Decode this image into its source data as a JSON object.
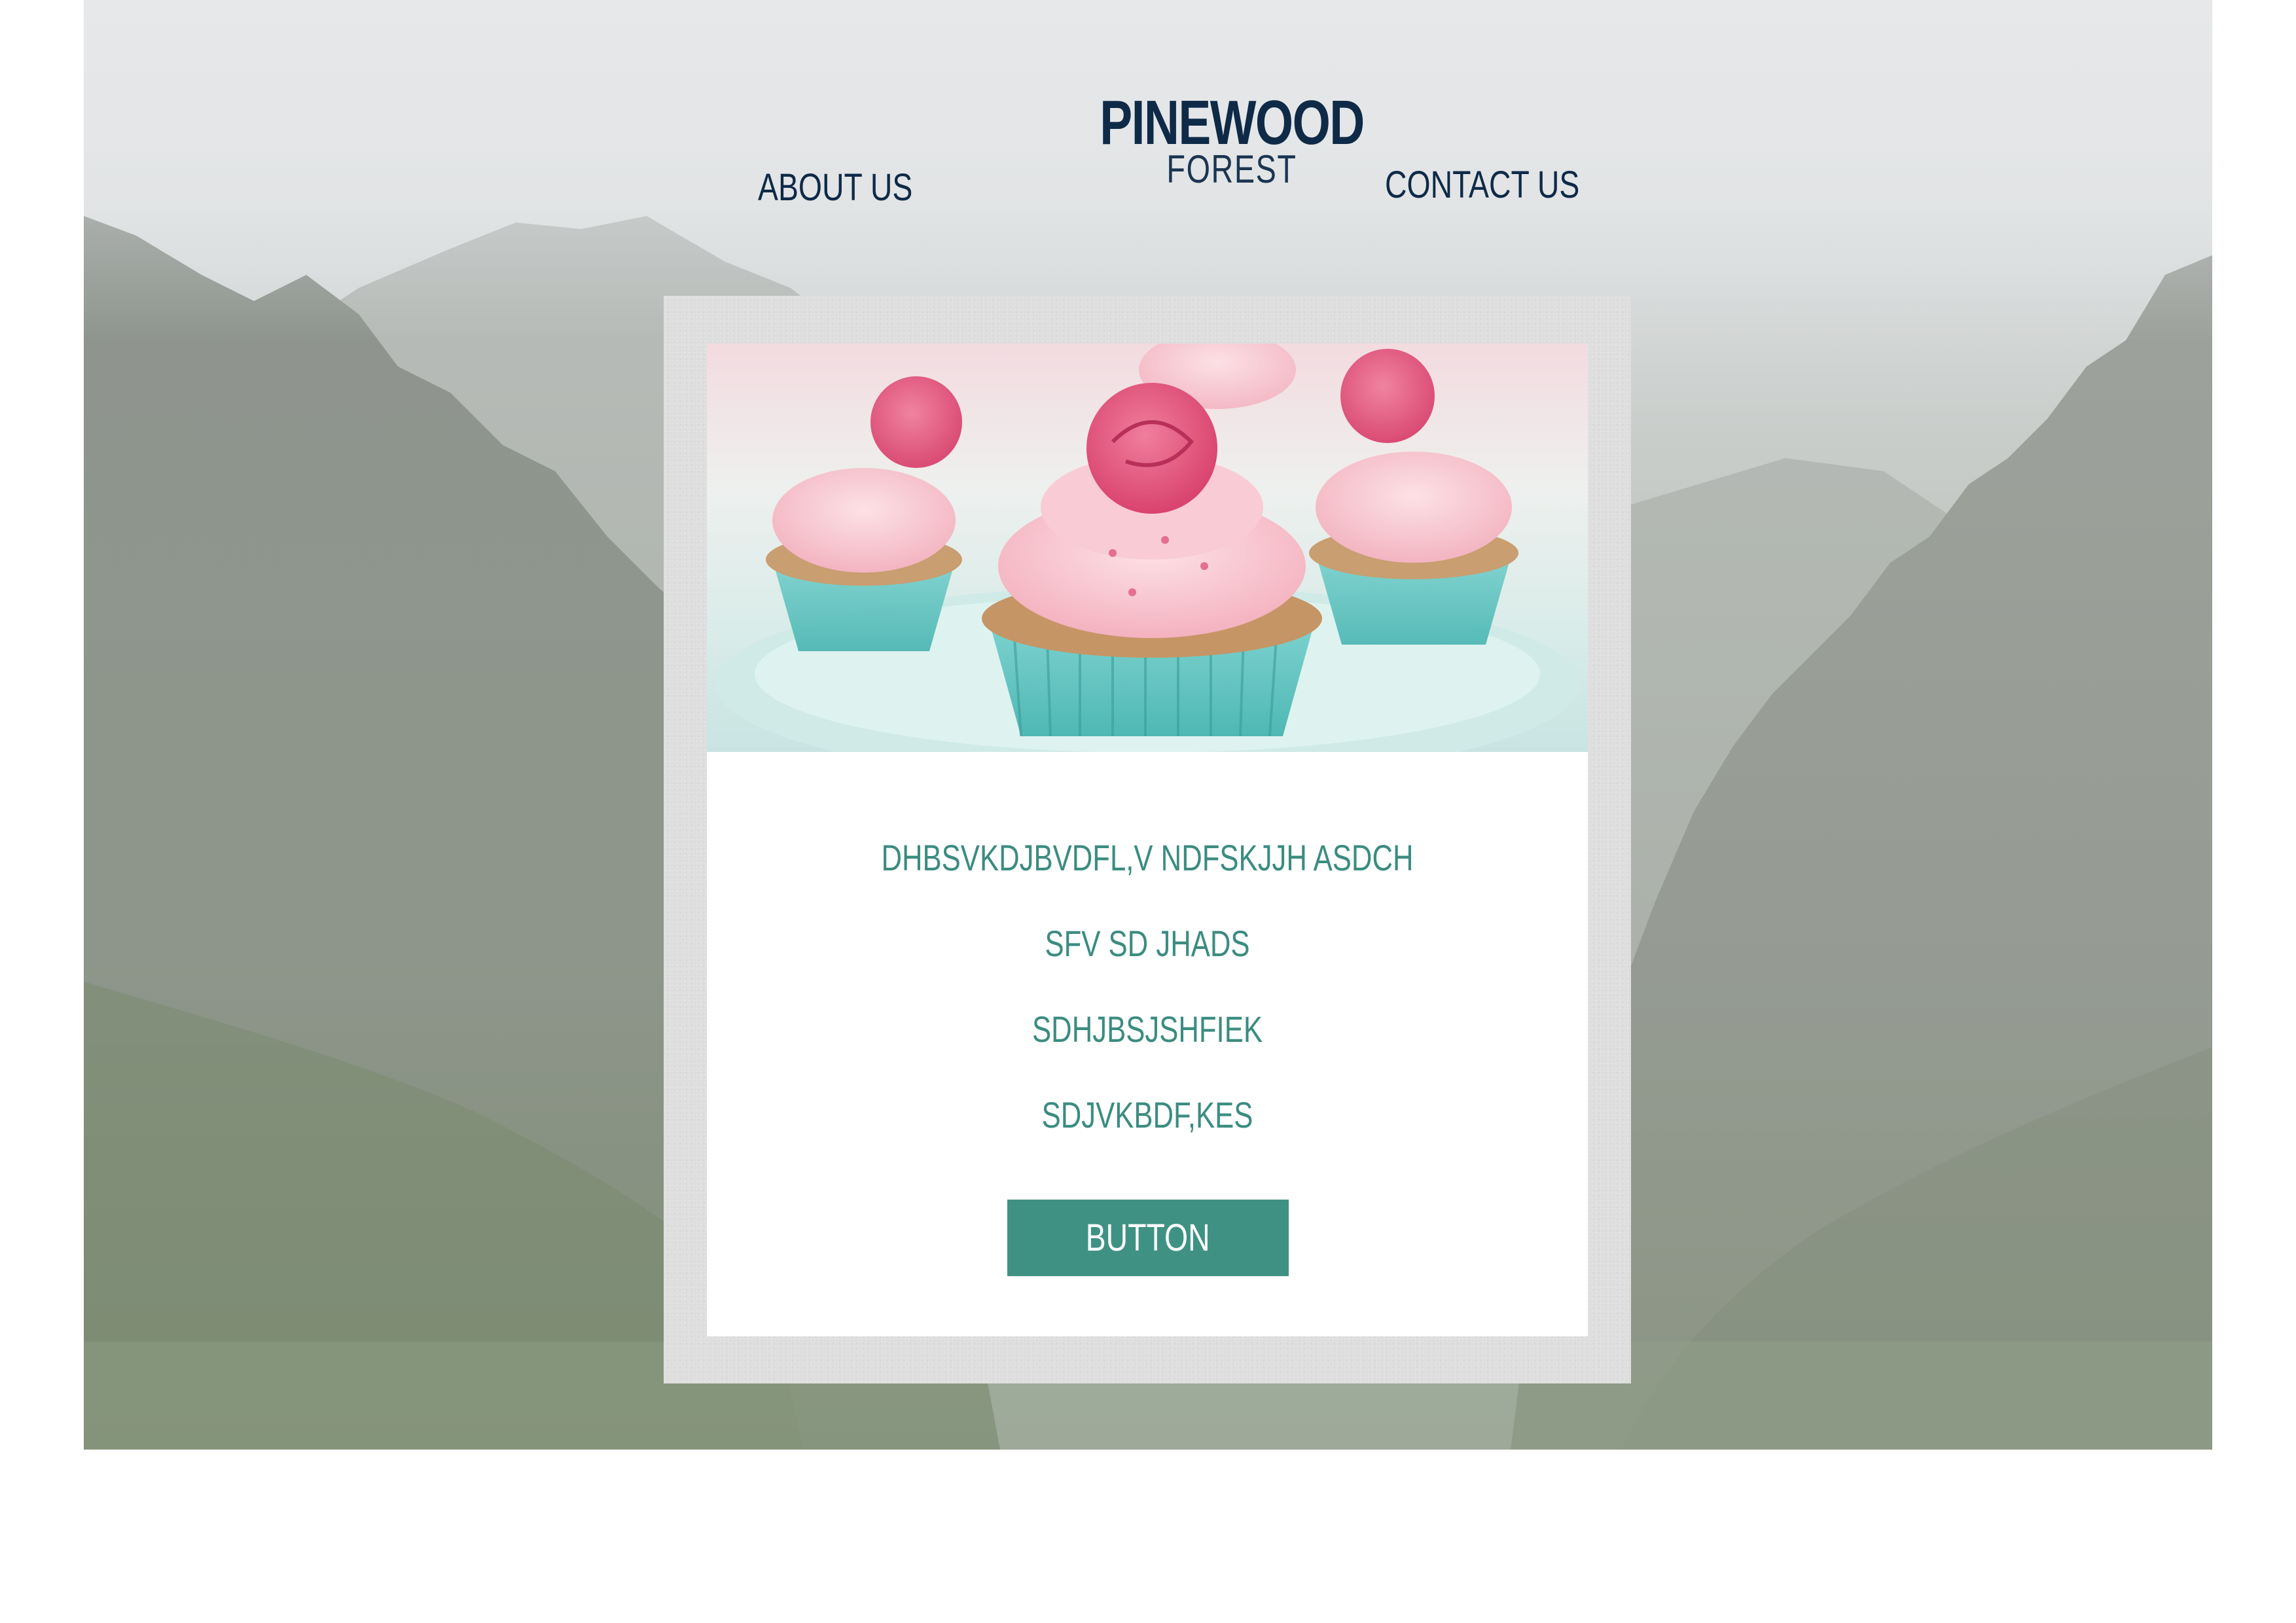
{
  "header": {
    "brand_name": "PINEWOOD",
    "brand_sub": "FOREST",
    "nav": {
      "about": "ABOUT US",
      "contact": "CONTACT US"
    }
  },
  "card": {
    "image_icon": "cupcakes-photo",
    "lines": [
      "DHBSVKDJBVDFL,V NDFSKJJH ASDCH",
      "SFV SD JHADS",
      "SDHJBSJSHFIEK",
      "SDJVKBDF,KES"
    ],
    "button_label": "BUTTON"
  },
  "colors": {
    "brand": "#0e2a47",
    "accent": "#3f9283",
    "text_accent": "#3b8c80",
    "frame": "#dedede"
  }
}
